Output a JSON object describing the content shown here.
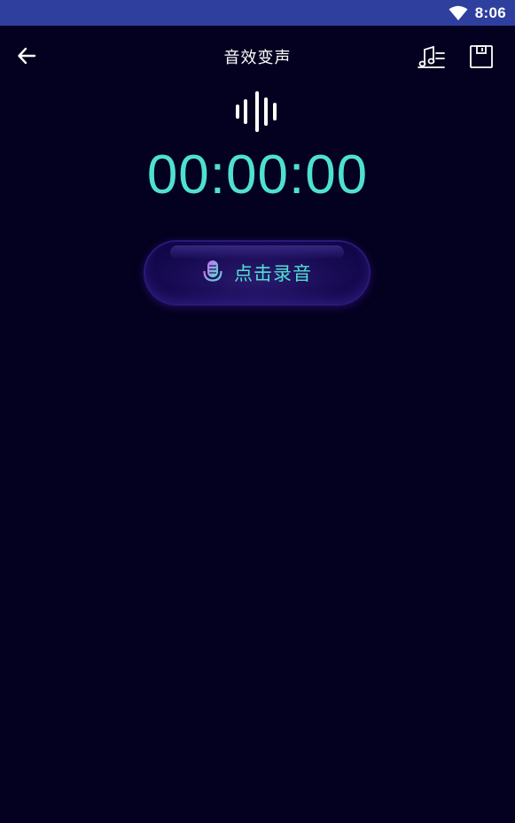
{
  "status_bar": {
    "time": "8:06",
    "wifi_icon": "wifi-icon"
  },
  "app_bar": {
    "title": "音效变声",
    "back_icon": "arrow-left-icon",
    "music_list_icon": "music-list-icon",
    "save_icon": "save-icon"
  },
  "recorder": {
    "wave_icon": "sound-wave-icon",
    "timer": "00:00:00",
    "record_button_label": "点击录音",
    "mic_icon": "microphone-icon"
  },
  "colors": {
    "background": "#04001f",
    "status_bar": "#2e3f9e",
    "accent": "#4fe0d2",
    "button": "#170a52"
  }
}
